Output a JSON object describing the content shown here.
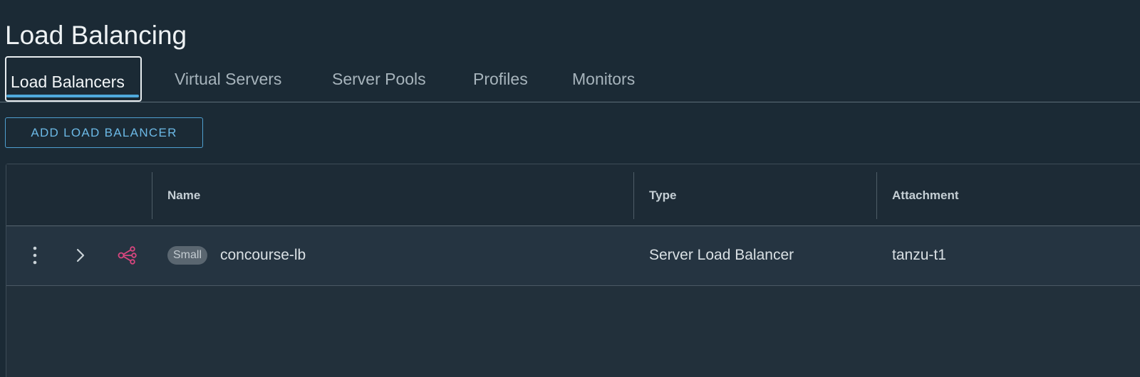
{
  "page": {
    "title": "Load Balancing"
  },
  "tabs": [
    {
      "label": "Load Balancers",
      "active": true
    },
    {
      "label": "Virtual Servers",
      "active": false
    },
    {
      "label": "Server Pools",
      "active": false
    },
    {
      "label": "Profiles",
      "active": false
    },
    {
      "label": "Monitors",
      "active": false
    }
  ],
  "toolbar": {
    "add_label": "ADD LOAD BALANCER"
  },
  "grid": {
    "columns": [
      "Name",
      "Type",
      "Attachment"
    ],
    "rows": [
      {
        "size": "Small",
        "name": "concourse-lb",
        "type": "Server Load Balancer",
        "attachment": "tanzu-t1",
        "icons": [
          "more-vertical-icon",
          "chevron-right-icon",
          "load-balancer-icon"
        ]
      }
    ]
  },
  "colors": {
    "background": "#1b2a35",
    "accent": "#4fa9dc",
    "lb_icon": "#d9467f"
  }
}
